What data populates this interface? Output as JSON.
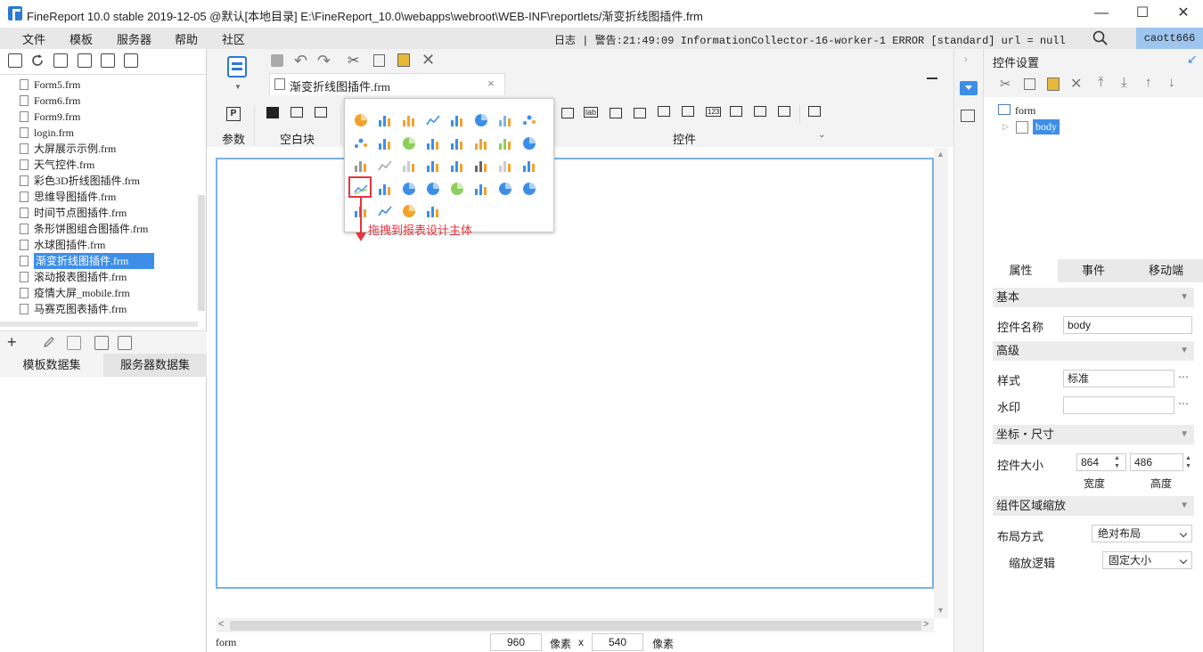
{
  "titlebar": {
    "title": "FineReport 10.0 stable 2019-12-05 @默认[本地目录]    E:\\FineReport_10.0\\webapps\\webroot\\WEB-INF\\reportlets/渐变折线图插件.frm",
    "minimize": "—",
    "maximize": "☐",
    "close": "✕"
  },
  "menubar": {
    "items": [
      "文件",
      "模板",
      "服务器",
      "帮助",
      "社区"
    ],
    "log": "日志 | 警告:21:49:09 InformationCollector-16-worker-1 ERROR [standard] url = null",
    "user": "caott666"
  },
  "file_list": [
    "Form5.frm",
    "Form6.frm",
    "Form9.frm",
    "login.frm",
    "大屏展示示例.frm",
    "天气控件.frm",
    "彩色3D折线图插件.frm",
    "思维导图插件.frm",
    "时间节点图插件.frm",
    "条形饼图组合图插件.frm",
    "水球图插件.frm",
    "渐变折线图插件.frm",
    "滚动报表图插件.frm",
    "疫情大屏_mobile.frm",
    "马赛克图表插件.frm"
  ],
  "selected_file": "渐变折线图插件.frm",
  "dataset_tabs": [
    "模板数据集",
    "服务器数据集"
  ],
  "designer": {
    "file_tab": "渐变折线图插件.frm",
    "groups": {
      "param": "参数",
      "blank": "空白块",
      "widget": "控件"
    },
    "drag_hint": "拖拽到报表设计主体"
  },
  "status": {
    "label": "form",
    "width": "960",
    "unit1": "像素",
    "x": "x",
    "height": "540",
    "unit2": "像素"
  },
  "right": {
    "header": "控件设置",
    "tree_root": "form",
    "tree_child": "body",
    "tabs": [
      "属性",
      "事件",
      "移动端"
    ],
    "sections": {
      "basic": "基本",
      "advanced": "高级",
      "coord": "坐标・尺寸",
      "zoom": "组件区域缩放"
    },
    "name_label": "控件名称",
    "name_value": "body",
    "style_label": "样式",
    "style_value": "标准",
    "watermark_label": "水印",
    "watermark_value": "",
    "ellipsis": "⋯",
    "size_label": "控件大小",
    "size_w": "864",
    "size_h": "486",
    "w_label": "宽度",
    "h_label": "高度",
    "layout_label": "布局方式",
    "layout_value": "绝对布局",
    "scale_label": "缩放逻辑",
    "scale_value": "固定大小"
  },
  "colors": {
    "accent": "#3d8ee8",
    "hint": "#e8343c",
    "user_bg": "#9ec5ee"
  }
}
